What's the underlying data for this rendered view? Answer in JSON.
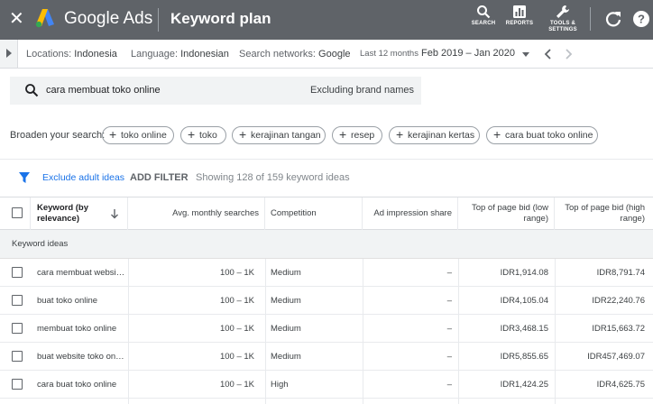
{
  "topbar": {
    "close_icon": "close-icon",
    "app_name": "Google Ads",
    "page_title": "Keyword plan",
    "search_label": "SEARCH",
    "reports_label": "REPORTS",
    "tools_label_1": "TOOLS &",
    "tools_label_2": "SETTINGS"
  },
  "filters": {
    "locations_key": "Locations:",
    "locations_val": "Indonesia",
    "language_key": "Language:",
    "language_val": "Indonesian",
    "networks_key": "Search networks:",
    "networks_val": "Google",
    "date_label": "Last 12 months",
    "date_range": "Feb 2019 – Jan 2020"
  },
  "search": {
    "query": "cara membuat toko online",
    "exclude_label": "Excluding brand names"
  },
  "broaden": {
    "label": "Broaden your search:",
    "chips": [
      "toko online",
      "toko",
      "kerajinan tangan",
      "resep",
      "kerajinan kertas",
      "cara buat toko online"
    ]
  },
  "toolbar": {
    "exclude_adult": "Exclude adult ideas",
    "add_filter": "ADD FILTER",
    "showing": "Showing 128 of 159 keyword ideas"
  },
  "table": {
    "headers": {
      "keyword_1": "Keyword (by",
      "keyword_2": "relevance)",
      "searches": "Avg. monthly searches",
      "competition": "Competition",
      "impression": "Ad impression share",
      "low_1": "Top of page bid (low",
      "low_2": "range)",
      "high_1": "Top of page bid (high",
      "high_2": "range)"
    },
    "section_label": "Keyword ideas",
    "rows": [
      {
        "keyword": "cara membuat websi…",
        "searches": "100 – 1K",
        "competition": "Medium",
        "impression": "–",
        "low": "IDR1,914.08",
        "high": "IDR8,791.74"
      },
      {
        "keyword": "buat toko online",
        "searches": "100 – 1K",
        "competition": "Medium",
        "impression": "–",
        "low": "IDR4,105.04",
        "high": "IDR22,240.76"
      },
      {
        "keyword": "membuat toko online",
        "searches": "100 – 1K",
        "competition": "Medium",
        "impression": "–",
        "low": "IDR3,468.15",
        "high": "IDR15,663.72"
      },
      {
        "keyword": "buat website toko onl…",
        "searches": "100 – 1K",
        "competition": "Medium",
        "impression": "–",
        "low": "IDR5,855.65",
        "high": "IDR457,469.07"
      },
      {
        "keyword": "cara buat toko online",
        "searches": "100 – 1K",
        "competition": "High",
        "impression": "–",
        "low": "IDR1,424.25",
        "high": "IDR4,625.75"
      }
    ]
  }
}
